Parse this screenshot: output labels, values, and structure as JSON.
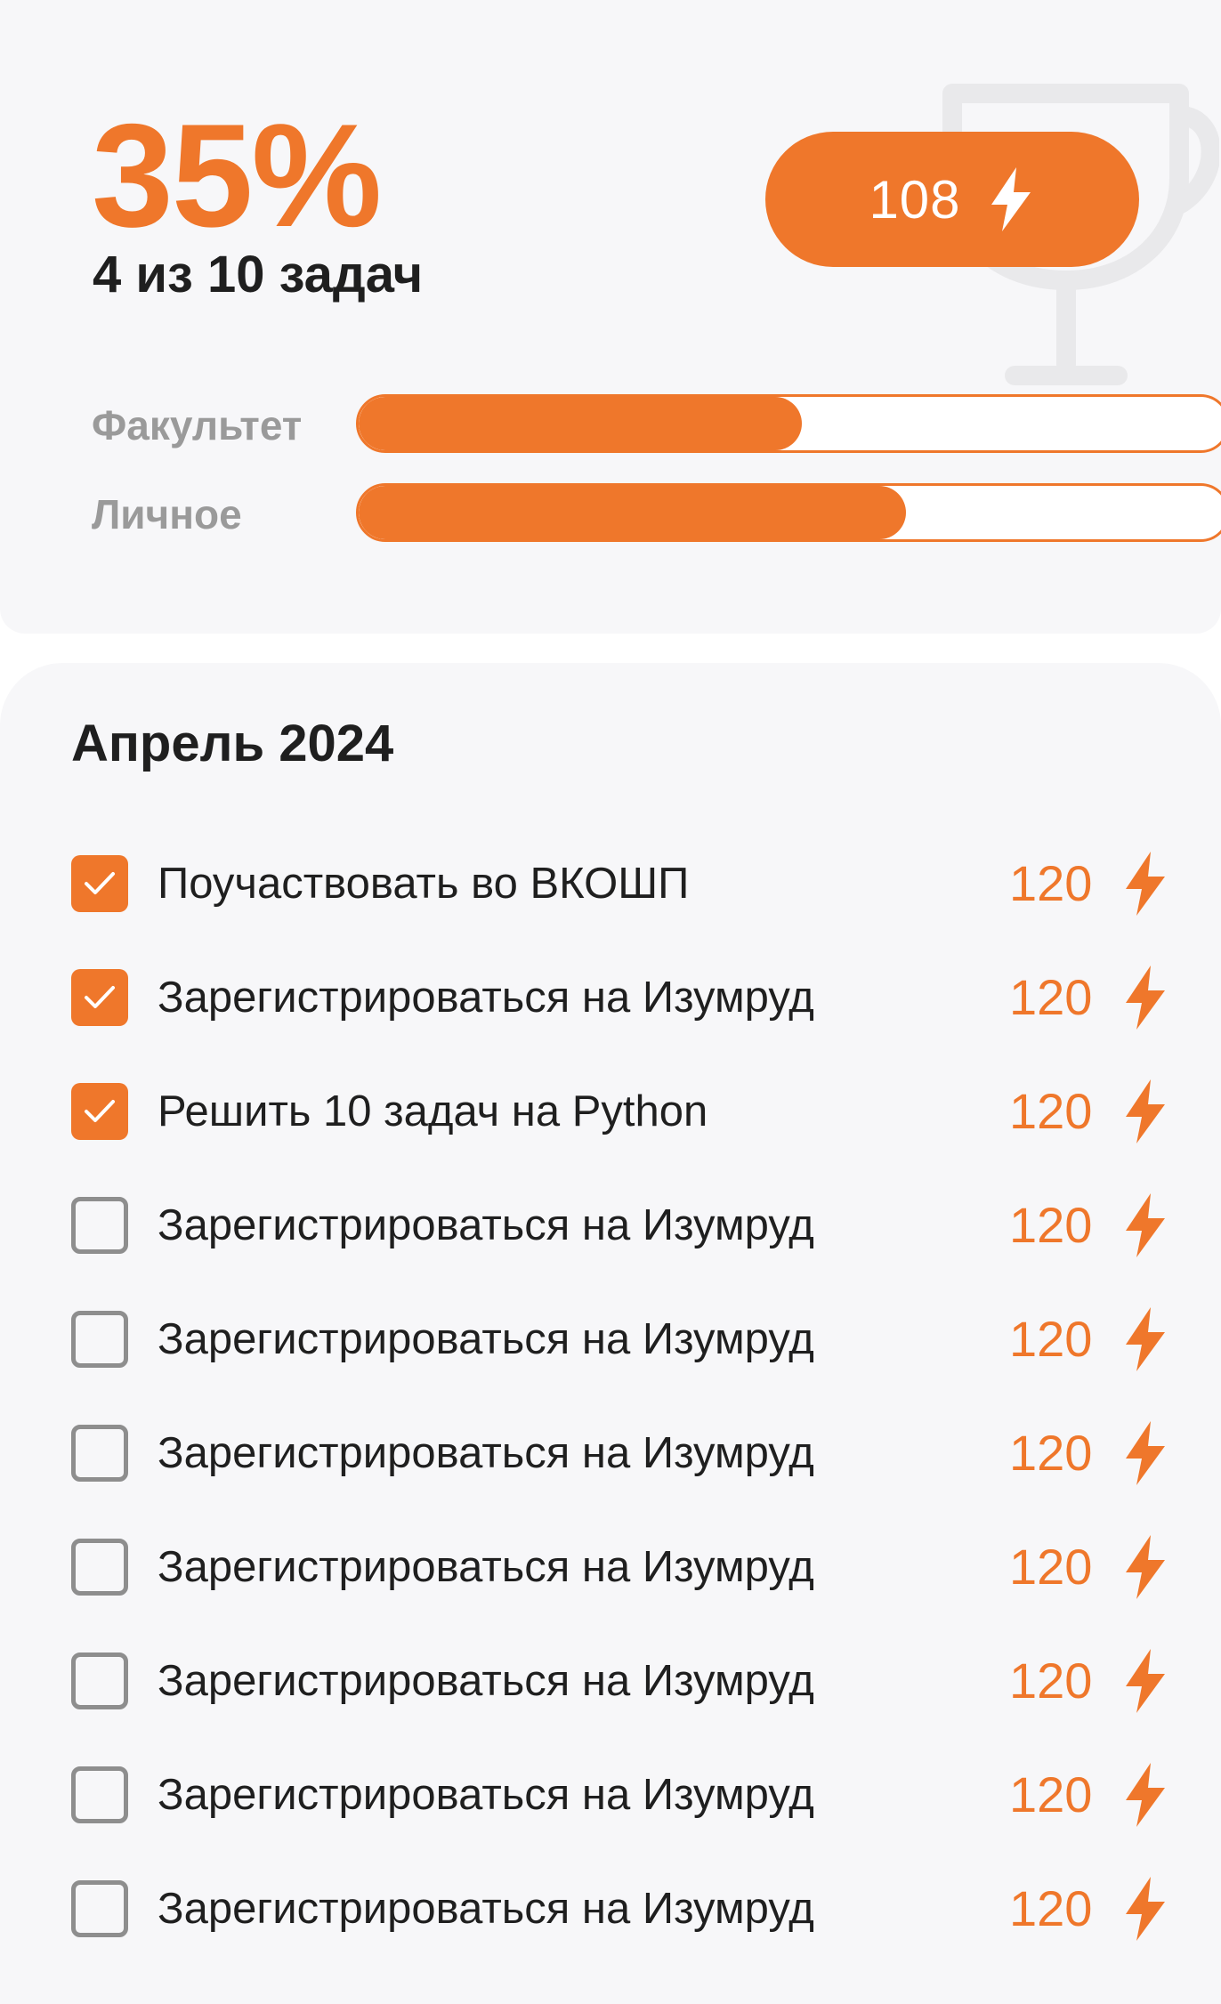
{
  "progress": {
    "percent": "35%",
    "tasks_done_text": "4 из 10 задач",
    "points_total": "108",
    "bars": [
      {
        "label": "Факультет",
        "fill_fraction": 0.51
      },
      {
        "label": "Личное",
        "fill_fraction": 0.63
      }
    ]
  },
  "tasks_section": {
    "month": "Апрель 2024",
    "tasks": [
      {
        "label": "Поучаствовать во ВКОШП",
        "points": "120",
        "checked": true
      },
      {
        "label": "Зарегистрироваться на Изумруд",
        "points": "120",
        "checked": true
      },
      {
        "label": "Решить 10 задач на Python",
        "points": "120",
        "checked": true
      },
      {
        "label": "Зарегистрироваться на Изумруд",
        "points": "120",
        "checked": false
      },
      {
        "label": "Зарегистрироваться на Изумруд",
        "points": "120",
        "checked": false
      },
      {
        "label": "Зарегистрироваться на Изумруд",
        "points": "120",
        "checked": false
      },
      {
        "label": "Зарегистрироваться на Изумруд",
        "points": "120",
        "checked": false
      },
      {
        "label": "Зарегистрироваться на Изумруд",
        "points": "120",
        "checked": false
      },
      {
        "label": "Зарегистрироваться на Изумруд",
        "points": "120",
        "checked": false
      },
      {
        "label": "Зарегистрироваться на Изумруд",
        "points": "120",
        "checked": false
      }
    ]
  },
  "icons": {
    "points": "lightning-bolt-icon",
    "background": "trophy-icon",
    "check": "checkmark-icon"
  },
  "colors": {
    "accent": "#ef772b",
    "card_background": "#f7f7f9",
    "text_primary": "#1f1f1f",
    "text_muted": "#9a9a9a",
    "checkbox_border": "#8e8e8e"
  }
}
